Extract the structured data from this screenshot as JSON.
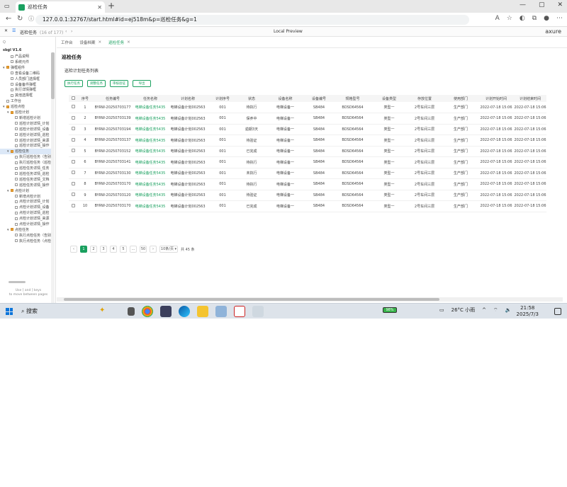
{
  "browser": {
    "tab_title": "巡检任务",
    "url": "127.0.0.1:32767/start.html#id=ej518m&p=巡检任务&g=1"
  },
  "axure": {
    "project": "巡检任务",
    "project_sub": "(16 of 177)",
    "center": "Local Preview",
    "logo": "axure"
  },
  "sidebar": {
    "search_placeholder": "Q",
    "title": "sbgl V1.6",
    "items": [
      {
        "label": "产品说明",
        "level": 1,
        "type": "page"
      },
      {
        "label": "系统元件",
        "level": 1,
        "type": "page"
      },
      {
        "label": "弹框组件",
        "level": 0,
        "type": "folder",
        "expanded": true
      },
      {
        "label": "查看设备二维码",
        "level": 1,
        "type": "page"
      },
      {
        "label": "人员部门选择框",
        "level": 1,
        "type": "page"
      },
      {
        "label": "设备备件弹框",
        "level": 1,
        "type": "page"
      },
      {
        "label": "执行详情弹框",
        "level": 1,
        "type": "page"
      },
      {
        "label": "其他选择框",
        "level": 1,
        "type": "page"
      },
      {
        "label": "工作台",
        "level": 0,
        "type": "page"
      },
      {
        "label": "巡检点检",
        "level": 0,
        "type": "folder",
        "expanded": true
      },
      {
        "label": "巡检计划",
        "level": 1,
        "type": "folder",
        "expanded": true
      },
      {
        "label": "新增巡检计划",
        "level": 2,
        "type": "page"
      },
      {
        "label": "巡检计划详情_计划",
        "level": 2,
        "type": "page"
      },
      {
        "label": "巡检计划详情_设备",
        "level": 2,
        "type": "page"
      },
      {
        "label": "巡检计划详情_巡检",
        "level": 2,
        "type": "page"
      },
      {
        "label": "巡检计划详情_来源",
        "level": 2,
        "type": "page"
      },
      {
        "label": "巡检计划详情_操作",
        "level": 2,
        "type": "page"
      },
      {
        "label": "巡检任务",
        "level": 1,
        "type": "folder",
        "active": true
      },
      {
        "label": "执行巡检任务（告别",
        "level": 2,
        "type": "page"
      },
      {
        "label": "执行巡检任务（巡检",
        "level": 2,
        "type": "page"
      },
      {
        "label": "巡检任务详情_任务",
        "level": 2,
        "type": "page"
      },
      {
        "label": "巡检任务详情_巡检",
        "level": 2,
        "type": "page"
      },
      {
        "label": "巡检任务详情_文档",
        "level": 2,
        "type": "page"
      },
      {
        "label": "巡检任务详情_操作",
        "level": 2,
        "type": "page"
      },
      {
        "label": "点检计划",
        "level": 1,
        "type": "folder",
        "expanded": true
      },
      {
        "label": "新增点检计划",
        "level": 2,
        "type": "page"
      },
      {
        "label": "点检计划详情_计划",
        "level": 2,
        "type": "page"
      },
      {
        "label": "点检计划详情_设备",
        "level": 2,
        "type": "page"
      },
      {
        "label": "点检计划详情_巡检",
        "level": 2,
        "type": "page"
      },
      {
        "label": "点检计划详情_来源",
        "level": 2,
        "type": "page"
      },
      {
        "label": "点检计划详情_操作",
        "level": 2,
        "type": "page"
      },
      {
        "label": "点检任务",
        "level": 1,
        "type": "folder",
        "expanded": true
      },
      {
        "label": "执行点检任务（告别",
        "level": 2,
        "type": "page"
      },
      {
        "label": "执行点检任务（点检",
        "level": 2,
        "type": "page"
      }
    ],
    "hint_line1": "Use [ and ] keys",
    "hint_line2": "to move between pages"
  },
  "content": {
    "tabs": [
      {
        "label": "工作台",
        "closable": false,
        "active": false
      },
      {
        "label": "设备档案",
        "closable": true,
        "active": false
      },
      {
        "label": "巡检任务",
        "closable": true,
        "active": true
      }
    ],
    "page_title": "巡检任务",
    "card_title": "巡检计划任务列表",
    "buttons": [
      "执行任务",
      "调整任务",
      "审核验证",
      "导出"
    ],
    "columns": [
      "序号",
      "任务编号",
      "任务名称",
      "计划名称",
      "计划序号",
      "状态",
      "设备名称",
      "设备编号",
      "规格型号",
      "设备类型",
      "存放位置",
      "使用部门",
      "计划开始时间",
      "计划结束时间"
    ],
    "rows": [
      [
        "1",
        "BYRW-20250703177",
        "电梯设备任务5435",
        "电梯设备计划002563",
        "001",
        "待执行",
        "电梯设备一",
        "SB484",
        "BDSD64564",
        "类型一",
        "2号车间三层",
        "生产部门",
        "2022-07-18 15:06",
        "2022-07-18 15:06"
      ],
      [
        "2",
        "BYRW-20250703139",
        "电梯设备任务5435",
        "电梯设备计划002563",
        "001",
        "保养中",
        "电梯设备一",
        "SB484",
        "BDSD64564",
        "类型一",
        "2号车间三层",
        "生产部门",
        "2022-07-18 15:06",
        "2022-07-18 15:06"
      ],
      [
        "3",
        "BYRW-20250703194",
        "电梯设备任务5435",
        "电梯设备计划002563",
        "001",
        "逾期3天",
        "电梯设备一",
        "SB484",
        "BDSD64564",
        "类型一",
        "2号车间三层",
        "生产部门",
        "2022-07-18 15:06",
        "2022-07-18 15:06"
      ],
      [
        "4",
        "BYRW-20250703137",
        "电梯设备任务5435",
        "电梯设备计划002563",
        "001",
        "待验证",
        "电梯设备一",
        "SB484",
        "BDSD64564",
        "类型一",
        "2号车间三层",
        "生产部门",
        "2022-07-18 15:06",
        "2022-07-18 15:06"
      ],
      [
        "5",
        "BYRW-20250703152",
        "电梯设备任务5435",
        "电梯设备计划002563",
        "001",
        "已完成",
        "电梯设备一",
        "SB484",
        "BDSD64564",
        "类型一",
        "2号车间三层",
        "生产部门",
        "2022-07-18 15:06",
        "2022-07-18 15:06"
      ],
      [
        "6",
        "BYRW-20250703141",
        "电梯设备任务5435",
        "电梯设备计划002563",
        "001",
        "待执行",
        "电梯设备一",
        "SB484",
        "BDSD64564",
        "类型一",
        "2号车间三层",
        "生产部门",
        "2022-07-18 15:06",
        "2022-07-18 15:06"
      ],
      [
        "7",
        "BYRW-20250703130",
        "电梯设备任务5435",
        "电梯设备计划002563",
        "001",
        "未执行",
        "电梯设备一",
        "SB484",
        "BDSD64564",
        "类型一",
        "2号车间三层",
        "生产部门",
        "2022-07-18 15:06",
        "2022-07-18 15:06"
      ],
      [
        "8",
        "BYRW-20250703170",
        "电梯设备任务5435",
        "电梯设备计划002563",
        "001",
        "待执行",
        "电梯设备一",
        "SB484",
        "BDSD64564",
        "类型一",
        "2号车间三层",
        "生产部门",
        "2022-07-18 15:06",
        "2022-07-18 15:06"
      ],
      [
        "9",
        "BYRW-20250703120",
        "电梯设备任务5435",
        "电梯设备计划002563",
        "001",
        "待验证",
        "电梯设备一",
        "SB484",
        "BDSD64564",
        "类型一",
        "2号车间三层",
        "生产部门",
        "2022-07-18 15:06",
        "2022-07-18 15:06"
      ],
      [
        "10",
        "BYRW-20250703170",
        "电梯设备任务5435",
        "电梯设备计划002563",
        "001",
        "已完成",
        "电梯设备一",
        "SB484",
        "BDSD64564",
        "类型一",
        "2号车间三层",
        "生产部门",
        "2022-07-18 15:06",
        "2022-07-18 15:06"
      ]
    ],
    "pager": {
      "prev": "‹",
      "pages": [
        "1",
        "2",
        "3",
        "4",
        "5"
      ],
      "ellipsis": "…",
      "last": "50",
      "next": "›",
      "page_size": "10条/页 ▾",
      "total": "共 45 条"
    }
  },
  "taskbar": {
    "search": "搜索",
    "battery": "98%",
    "weather": "26°C 小雨",
    "time": "21:58",
    "date": "2025/7/3"
  },
  "colors": {
    "accent": "#1aa05f",
    "sidebar_active": "#dce8f7"
  }
}
